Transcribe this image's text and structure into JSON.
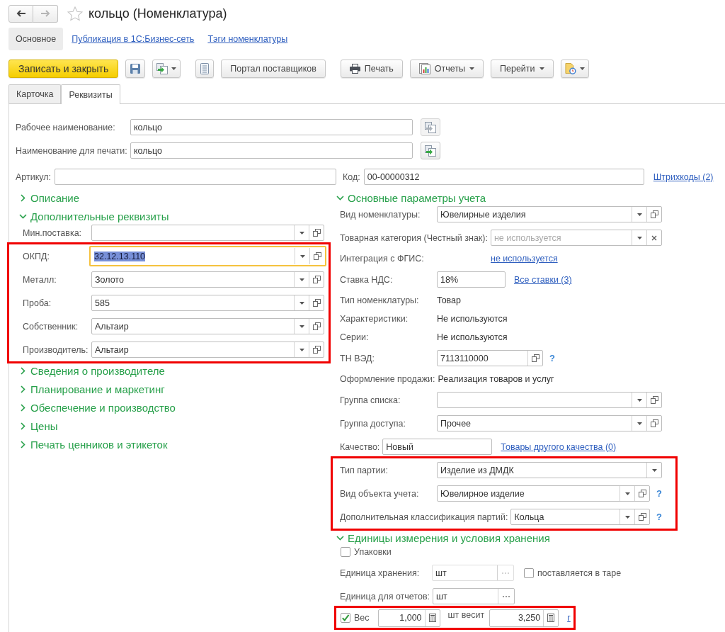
{
  "window": {
    "title": "кольцо (Номенклатура)",
    "favorite": false,
    "back_enabled": true,
    "forward_enabled": false
  },
  "sections": [
    {
      "label": "Основное",
      "selected": true
    },
    {
      "label": "Публикация в 1С:Бизнес-сеть",
      "selected": false
    },
    {
      "label": "Тэги номенклатуры",
      "selected": false
    }
  ],
  "toolbar": [
    {
      "buttons": [
        {
          "kind": "primary",
          "label": "Записать и закрыть",
          "dropdown": false
        },
        {
          "kind": "save",
          "dropdown": false
        },
        {
          "kind": "copy",
          "dropdown": true
        }
      ]
    },
    {
      "buttons": [
        {
          "kind": "list",
          "dropdown": false
        },
        {
          "kind": "text",
          "label": "Портал поставщиков",
          "dropdown": false
        }
      ]
    },
    {
      "buttons": [
        {
          "kind": "print",
          "label": "Печать",
          "dropdown": false
        },
        {
          "kind": "reports",
          "label": "Отчеты",
          "dropdown": true
        },
        {
          "kind": "text",
          "label": "Перейти",
          "dropdown": true
        },
        {
          "kind": "attach",
          "dropdown": true
        }
      ]
    }
  ],
  "tabs": [
    {
      "label": "Карточка",
      "selected": false
    },
    {
      "label": "Реквизиты",
      "selected": true
    }
  ],
  "name_fields": [
    {
      "label": "Рабочее наименование:",
      "value": "кольцо",
      "action_enabled": false
    },
    {
      "label": "Наименование для печати:",
      "value": "кольцо",
      "action_enabled": true
    }
  ],
  "article": {
    "label": "Артикул:"
  },
  "code": {
    "label": "Код:",
    "value": "00-00000312",
    "link": "Штрихкоды (2)"
  },
  "left_groups": [
    {
      "title": "Описание",
      "expanded": false
    },
    {
      "title": "Дополнительные реквизиты",
      "expanded": true,
      "blocks": [
        {
          "highlighted": false,
          "rows": [
            {
              "kind": "select",
              "label": "Мин.поставка:",
              "focused": false,
              "open": true,
              "clear": false
            }
          ]
        },
        {
          "highlighted": true,
          "rows": [
            {
              "kind": "select",
              "label": "ОКПД:",
              "value": "32.12.13.110",
              "focused": true,
              "open": true,
              "clear": false
            },
            {
              "kind": "select",
              "label": "Металл:",
              "value": "Золото",
              "focused": false,
              "open": true,
              "clear": false
            },
            {
              "kind": "select",
              "label": "Проба:",
              "value": "585",
              "focused": false,
              "open": true,
              "clear": false
            },
            {
              "kind": "select",
              "label": "Собственник:",
              "value": "Альтаир",
              "focused": false,
              "open": true,
              "clear": false
            },
            {
              "kind": "select",
              "label": "Производитель:",
              "value": "Альтаир",
              "focused": false,
              "open": true,
              "clear": false
            }
          ]
        }
      ]
    },
    {
      "title": "Сведения о производителе",
      "expanded": false
    },
    {
      "title": "Планирование и маркетинг",
      "expanded": false
    },
    {
      "title": "Обеспечение и производство",
      "expanded": false
    },
    {
      "title": "Цены",
      "expanded": false
    },
    {
      "title": "Печать ценников и этикеток",
      "expanded": false
    }
  ],
  "right_groups": [
    {
      "title": "Основные параметры учета",
      "expanded": true,
      "blocks": [
        {
          "highlighted": false,
          "rows": [
            {
              "kind": "select",
              "label": "Вид номенклатуры:",
              "value": "Ювелирные изделия",
              "focused": false,
              "open": true,
              "clear": false
            },
            {
              "kind": "select",
              "label": "Товарная категория (Честный знак):",
              "placeholder": "не используется",
              "focused": false,
              "open": false,
              "clear": true
            },
            {
              "kind": "link",
              "label": "Интеграция с ФГИС:",
              "link": "не используется"
            },
            {
              "kind": "input",
              "label": "Ставка НДС:",
              "value": "18%",
              "link": "Все ставки (3)"
            },
            {
              "kind": "text",
              "label": "Тип номенклатуры:",
              "value": "Товар"
            },
            {
              "kind": "text",
              "label": "Характеристики:",
              "value": "Не используются"
            },
            {
              "kind": "text",
              "label": "Серии:",
              "value": "Не используются"
            },
            {
              "kind": "code",
              "label": "ТН ВЭД:",
              "value": "7113110000",
              "help": "?"
            },
            {
              "kind": "text",
              "label": "Оформление продажи:",
              "value": "Реализация товаров и услуг"
            },
            {
              "kind": "select",
              "label": "Группа списка:",
              "focused": false,
              "open": true,
              "clear": false
            },
            {
              "kind": "select",
              "label": "Группа доступа:",
              "value": "Прочее",
              "focused": false,
              "open": true,
              "clear": false
            },
            {
              "kind": "inline-input",
              "label": "Качество:",
              "value": "Новый",
              "link": "Товары другого качества (0)"
            }
          ]
        },
        {
          "highlighted": true,
          "rows": [
            {
              "kind": "select",
              "label": "Тип партии:",
              "value": "Изделие из ДМДК",
              "focused": false,
              "open": false,
              "clear": false
            },
            {
              "kind": "select",
              "label": "Вид объекта учета:",
              "value": "Ювелирное изделие",
              "focused": false,
              "open": true,
              "clear": false,
              "help": "?"
            },
            {
              "kind": "select",
              "label": "Дополнительная классификация партий:",
              "value": "Кольца",
              "focused": false,
              "open": true,
              "clear": false,
              "help": "?"
            }
          ]
        }
      ]
    },
    {
      "title": "Единицы измерения и условия хранения",
      "expanded": true,
      "blocks": [
        {
          "highlighted": false,
          "rows": [
            {
              "kind": "checkbox",
              "label": "Упаковки",
              "checked": false
            },
            {
              "kind": "unit",
              "label": "Единица хранения:",
              "value": "шт",
              "disabled": true,
              "option": {
                "label": "поставляется в таре",
                "checked": false
              }
            },
            {
              "kind": "unit",
              "label": "Единица для отчетов:",
              "value": "шт",
              "disabled": false
            }
          ]
        },
        {
          "highlighted": true,
          "rows": [
            {
              "kind": "weight",
              "label": "Вес",
              "checked": true,
              "quantity": "1,000",
              "per_label": "шт весит",
              "weight": "3,250",
              "unit": "г"
            }
          ]
        }
      ]
    }
  ]
}
